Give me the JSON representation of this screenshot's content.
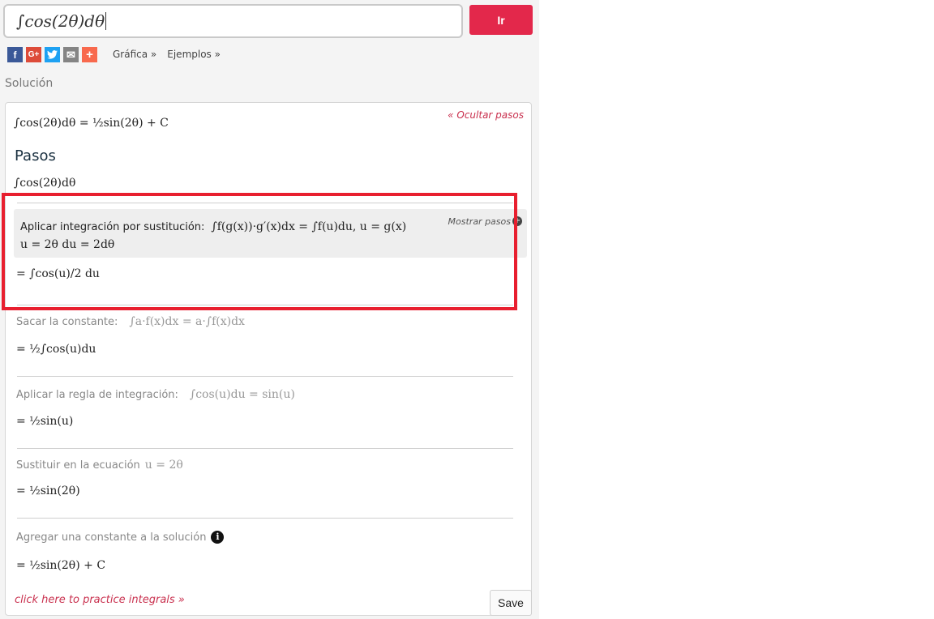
{
  "query": {
    "value": "∫cos(2θ)dθ"
  },
  "go_button": "Ir",
  "share": {
    "facebook": "f",
    "googleplus": "G+",
    "email": "✉",
    "more": "+"
  },
  "links": {
    "grafica": "Gráfica »",
    "ejemplos": "Ejemplos »"
  },
  "solution_label": "Solución",
  "card": {
    "hide_steps": "« Ocultar pasos",
    "answer": "∫cos(2θ)dθ = ½sin(2θ) + C",
    "pasos_title": "Pasos",
    "given": "∫cos(2θ)dθ",
    "step1": {
      "text": "Aplicar integración por sustitución:",
      "rule": "∫f(g(x))·g′(x)dx = ∫f(u)du,   u = g(x)",
      "sub": "u = 2θ    du = 2dθ",
      "result": "= ∫cos(u)/2 du",
      "mostrar": "Mostrar pasos"
    },
    "step2": {
      "text": "Sacar la constante:",
      "rule": "∫a·f(x)dx = a·∫f(x)dx",
      "result": "= ½∫cos(u)du"
    },
    "step3": {
      "text": "Aplicar la regla de integración:",
      "rule": "∫cos(u)du = sin(u)",
      "result": "= ½sin(u)"
    },
    "step4": {
      "text": "Sustituir en la ecuación",
      "rule": "u = 2θ",
      "result": "= ½sin(2θ)"
    },
    "step5": {
      "text": "Agregar una constante a la solución",
      "result": "= ½sin(2θ) + C"
    },
    "practice_link": "click here to practice integrals »",
    "save_button": "Save"
  },
  "colors": {
    "accent": "#e3284b",
    "highlight": "#e81f2f",
    "link": "#c9304e"
  },
  "icons": [
    "facebook-icon",
    "googleplus-icon",
    "twitter-icon",
    "email-icon",
    "addthis-icon",
    "plus-circle-icon",
    "info-icon"
  ]
}
